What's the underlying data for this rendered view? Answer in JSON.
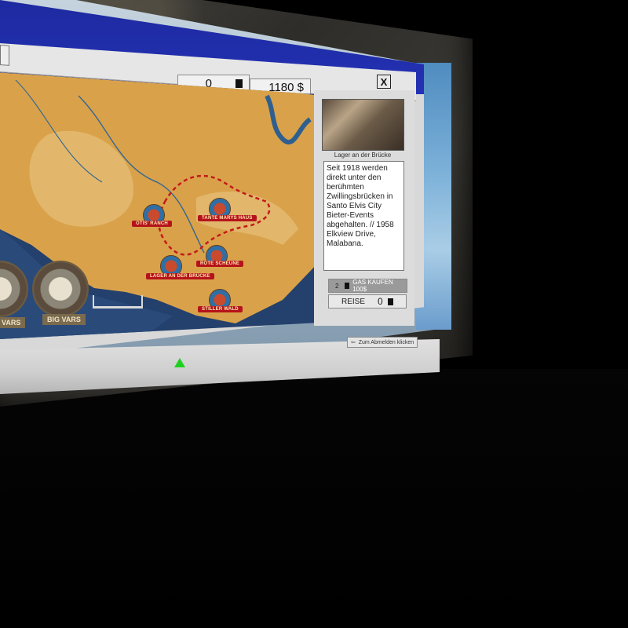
{
  "topbar": {
    "count_value": "0",
    "money_value": "1180 $",
    "close_label": "X"
  },
  "map": {
    "locations": [
      {
        "label": "OTIS' RANCH"
      },
      {
        "label": "TANTE MARYS HAUS"
      },
      {
        "label": "LAGER AN DER BRÜCKE"
      },
      {
        "label": "ROTE SCHEUNE"
      },
      {
        "label": "STILLER WALD"
      }
    ],
    "medals": [
      {
        "label": "VARS"
      },
      {
        "label": "BIG VARS"
      }
    ],
    "colors": {
      "land": "#d9a24a",
      "water": "#24406d",
      "route": "#c41a1a",
      "label_bg": "#b5131b"
    }
  },
  "side_panel": {
    "photo_caption": "Lager an der Brücke",
    "description": "Seit 1918 werden direkt unter den berühmten Zwillingsbrücken in Santo Elvis City Bieter-Events abgehalten. // 1958 Elkview Drive, Malabana.",
    "buy_count": "2",
    "buy_label": "GAS KAUFEN 100$",
    "travel_label": "REISE",
    "travel_count": "0"
  },
  "footer": {
    "logout_label": "Zum Abmelden klicken"
  }
}
